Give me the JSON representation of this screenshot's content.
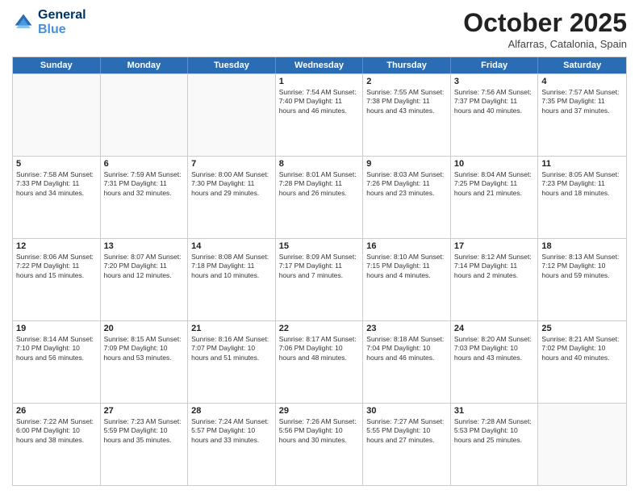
{
  "header": {
    "logo_line1": "General",
    "logo_line2": "Blue",
    "title": "October 2025",
    "subtitle": "Alfarras, Catalonia, Spain"
  },
  "days_of_week": [
    "Sunday",
    "Monday",
    "Tuesday",
    "Wednesday",
    "Thursday",
    "Friday",
    "Saturday"
  ],
  "rows": [
    [
      {
        "day": "",
        "text": ""
      },
      {
        "day": "",
        "text": ""
      },
      {
        "day": "",
        "text": ""
      },
      {
        "day": "1",
        "text": "Sunrise: 7:54 AM\nSunset: 7:40 PM\nDaylight: 11 hours and 46 minutes."
      },
      {
        "day": "2",
        "text": "Sunrise: 7:55 AM\nSunset: 7:38 PM\nDaylight: 11 hours and 43 minutes."
      },
      {
        "day": "3",
        "text": "Sunrise: 7:56 AM\nSunset: 7:37 PM\nDaylight: 11 hours and 40 minutes."
      },
      {
        "day": "4",
        "text": "Sunrise: 7:57 AM\nSunset: 7:35 PM\nDaylight: 11 hours and 37 minutes."
      }
    ],
    [
      {
        "day": "5",
        "text": "Sunrise: 7:58 AM\nSunset: 7:33 PM\nDaylight: 11 hours and 34 minutes."
      },
      {
        "day": "6",
        "text": "Sunrise: 7:59 AM\nSunset: 7:31 PM\nDaylight: 11 hours and 32 minutes."
      },
      {
        "day": "7",
        "text": "Sunrise: 8:00 AM\nSunset: 7:30 PM\nDaylight: 11 hours and 29 minutes."
      },
      {
        "day": "8",
        "text": "Sunrise: 8:01 AM\nSunset: 7:28 PM\nDaylight: 11 hours and 26 minutes."
      },
      {
        "day": "9",
        "text": "Sunrise: 8:03 AM\nSunset: 7:26 PM\nDaylight: 11 hours and 23 minutes."
      },
      {
        "day": "10",
        "text": "Sunrise: 8:04 AM\nSunset: 7:25 PM\nDaylight: 11 hours and 21 minutes."
      },
      {
        "day": "11",
        "text": "Sunrise: 8:05 AM\nSunset: 7:23 PM\nDaylight: 11 hours and 18 minutes."
      }
    ],
    [
      {
        "day": "12",
        "text": "Sunrise: 8:06 AM\nSunset: 7:22 PM\nDaylight: 11 hours and 15 minutes."
      },
      {
        "day": "13",
        "text": "Sunrise: 8:07 AM\nSunset: 7:20 PM\nDaylight: 11 hours and 12 minutes."
      },
      {
        "day": "14",
        "text": "Sunrise: 8:08 AM\nSunset: 7:18 PM\nDaylight: 11 hours and 10 minutes."
      },
      {
        "day": "15",
        "text": "Sunrise: 8:09 AM\nSunset: 7:17 PM\nDaylight: 11 hours and 7 minutes."
      },
      {
        "day": "16",
        "text": "Sunrise: 8:10 AM\nSunset: 7:15 PM\nDaylight: 11 hours and 4 minutes."
      },
      {
        "day": "17",
        "text": "Sunrise: 8:12 AM\nSunset: 7:14 PM\nDaylight: 11 hours and 2 minutes."
      },
      {
        "day": "18",
        "text": "Sunrise: 8:13 AM\nSunset: 7:12 PM\nDaylight: 10 hours and 59 minutes."
      }
    ],
    [
      {
        "day": "19",
        "text": "Sunrise: 8:14 AM\nSunset: 7:10 PM\nDaylight: 10 hours and 56 minutes."
      },
      {
        "day": "20",
        "text": "Sunrise: 8:15 AM\nSunset: 7:09 PM\nDaylight: 10 hours and 53 minutes."
      },
      {
        "day": "21",
        "text": "Sunrise: 8:16 AM\nSunset: 7:07 PM\nDaylight: 10 hours and 51 minutes."
      },
      {
        "day": "22",
        "text": "Sunrise: 8:17 AM\nSunset: 7:06 PM\nDaylight: 10 hours and 48 minutes."
      },
      {
        "day": "23",
        "text": "Sunrise: 8:18 AM\nSunset: 7:04 PM\nDaylight: 10 hours and 46 minutes."
      },
      {
        "day": "24",
        "text": "Sunrise: 8:20 AM\nSunset: 7:03 PM\nDaylight: 10 hours and 43 minutes."
      },
      {
        "day": "25",
        "text": "Sunrise: 8:21 AM\nSunset: 7:02 PM\nDaylight: 10 hours and 40 minutes."
      }
    ],
    [
      {
        "day": "26",
        "text": "Sunrise: 7:22 AM\nSunset: 6:00 PM\nDaylight: 10 hours and 38 minutes."
      },
      {
        "day": "27",
        "text": "Sunrise: 7:23 AM\nSunset: 5:59 PM\nDaylight: 10 hours and 35 minutes."
      },
      {
        "day": "28",
        "text": "Sunrise: 7:24 AM\nSunset: 5:57 PM\nDaylight: 10 hours and 33 minutes."
      },
      {
        "day": "29",
        "text": "Sunrise: 7:26 AM\nSunset: 5:56 PM\nDaylight: 10 hours and 30 minutes."
      },
      {
        "day": "30",
        "text": "Sunrise: 7:27 AM\nSunset: 5:55 PM\nDaylight: 10 hours and 27 minutes."
      },
      {
        "day": "31",
        "text": "Sunrise: 7:28 AM\nSunset: 5:53 PM\nDaylight: 10 hours and 25 minutes."
      },
      {
        "day": "",
        "text": ""
      }
    ]
  ]
}
